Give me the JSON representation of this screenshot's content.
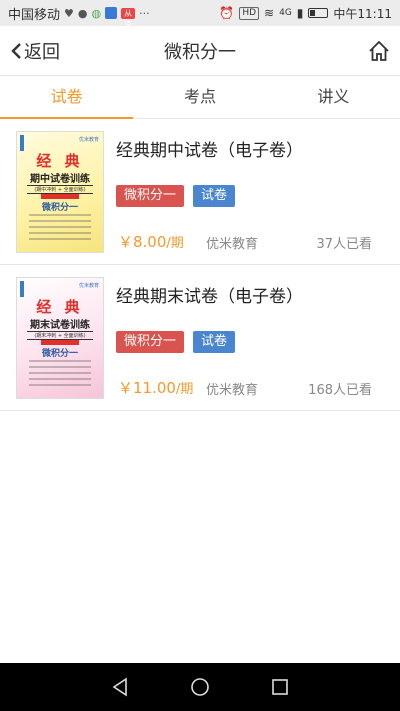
{
  "status_bar": {
    "carrier": "中国移动",
    "badge_hd": "HD",
    "signal": "4G",
    "time": "中午11:11",
    "red_badge": "从京",
    "more": "···"
  },
  "header": {
    "back_label": "返回",
    "title": "微积分一"
  },
  "tabs": [
    {
      "label": "试卷",
      "active": true
    },
    {
      "label": "考点",
      "active": false
    },
    {
      "label": "讲义",
      "active": false
    }
  ],
  "items": [
    {
      "title": "经典期中试卷（电子卷）",
      "tag1": "微积分一",
      "tag2": "试卷",
      "price": "￥8.00",
      "price_unit": "/期",
      "publisher": "优米教育",
      "views": "37人已看",
      "cover": {
        "big": "经 典",
        "sub": "期中试卷训练",
        "tiny": "(期中冲刺 + 全面训练)",
        "course": "微积分一",
        "pub": "优米教育"
      }
    },
    {
      "title": "经典期末试卷（电子卷）",
      "tag1": "微积分一",
      "tag2": "试卷",
      "price": "￥11.00",
      "price_unit": "/期",
      "publisher": "优米教育",
      "views": "168人已看",
      "cover": {
        "big": "经 典",
        "sub": "期末试卷训练",
        "tiny": "(期末冲刺 + 全面训练)",
        "course": "微积分一",
        "pub": "优米教育"
      }
    }
  ],
  "colors": {
    "accent": "#f39a2b",
    "tag_red": "#d9534f",
    "tag_blue": "#4a86d0"
  },
  "nav_icons": [
    "back-triangle-icon",
    "home-circle-icon",
    "recents-square-icon"
  ]
}
